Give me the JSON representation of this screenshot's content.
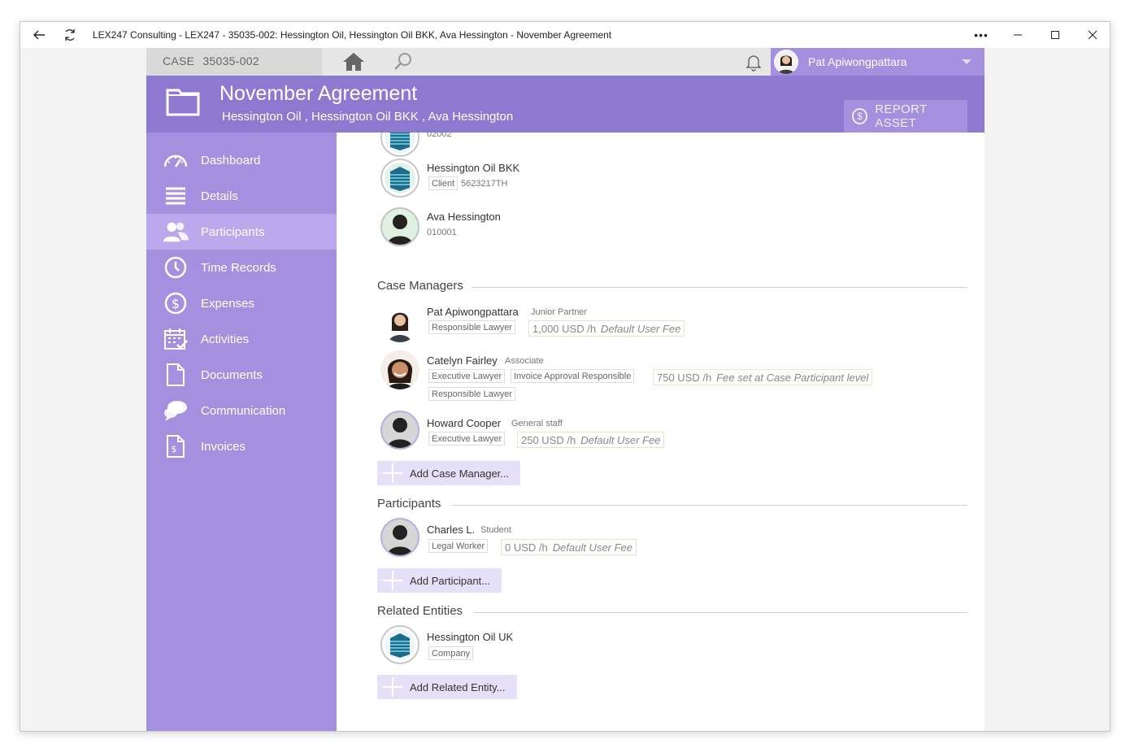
{
  "window": {
    "title": "LEX247 Consulting - LEX247 - 35035-002: Hessington Oil, Hessington Oil BKK, Ava Hessington - November Agreement"
  },
  "topbar": {
    "case_label": "CASE",
    "case_number": "35035-002",
    "user_name": "Pat Apiwongpattara"
  },
  "header": {
    "title": "November Agreement",
    "subtitle": "Hessington Oil ,  Hessington Oil BKK ,  Ava Hessington",
    "report_label": "REPORT ASSET"
  },
  "sidebar": {
    "items": [
      {
        "label": "Dashboard",
        "icon": "dashboard-icon"
      },
      {
        "label": "Details",
        "icon": "details-icon"
      },
      {
        "label": "Participants",
        "icon": "participants-icon",
        "active": true
      },
      {
        "label": "Time Records",
        "icon": "clock-icon"
      },
      {
        "label": "Expenses",
        "icon": "dollar-icon"
      },
      {
        "label": "Activities",
        "icon": "calendar-icon"
      },
      {
        "label": "Documents",
        "icon": "document-icon"
      },
      {
        "label": "Communication",
        "icon": "chat-icon"
      },
      {
        "label": "Invoices",
        "icon": "invoice-icon"
      }
    ]
  },
  "clients": [
    {
      "code": "02002"
    },
    {
      "name": "Hessington Oil BKK",
      "tag": "Client",
      "code": "5623217TH"
    },
    {
      "name": "Ava Hessington",
      "code": "010001"
    }
  ],
  "case_managers": {
    "title": "Case Managers",
    "people": [
      {
        "name": "Pat Apiwongpattara",
        "role": "Junior Partner",
        "tags": [
          "Responsible Lawyer"
        ],
        "fee": "1,000 USD /h",
        "fee_note": "Default User Fee"
      },
      {
        "name": "Catelyn Fairley",
        "role": "Associate",
        "tags": [
          "Executive Lawyer",
          "Invoice Approval Responsible",
          "Responsible Lawyer"
        ],
        "fee": "750 USD /h",
        "fee_note": "Fee set at Case Participant level"
      },
      {
        "name": "Howard Cooper",
        "role": "General staff",
        "tags": [
          "Executive Lawyer"
        ],
        "fee": "250 USD /h",
        "fee_note": "Default User Fee"
      }
    ],
    "add_label": "Add Case Manager..."
  },
  "participants": {
    "title": "Participants",
    "people": [
      {
        "name": "Charles L.",
        "role": "Student",
        "tags": [
          "Legal Worker"
        ],
        "fee": "0 USD /h",
        "fee_note": "Default User Fee"
      }
    ],
    "add_label": "Add Participant..."
  },
  "related": {
    "title": "Related Entities",
    "entities": [
      {
        "name": "Hessington Oil UK",
        "tag": "Company"
      }
    ],
    "add_label": "Add Related Entity..."
  }
}
